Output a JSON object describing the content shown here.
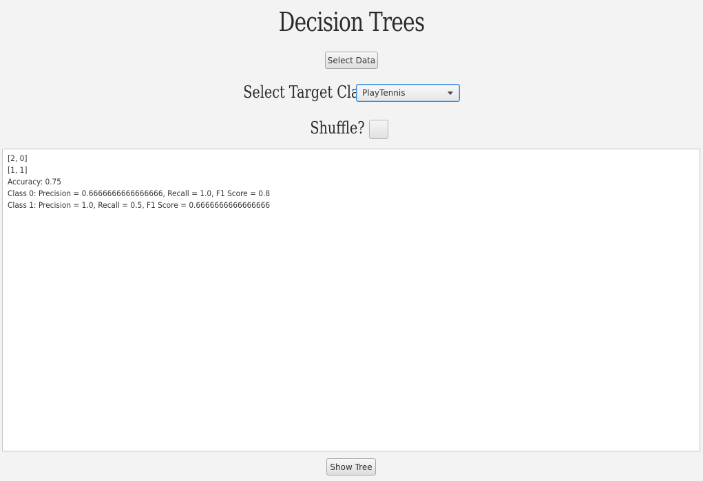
{
  "app": {
    "title": "Decision Trees"
  },
  "controls": {
    "select_data_label": "Select Data",
    "target_class_label": "Select Target Class",
    "target_class_value": "PlayTennis",
    "shuffle_label": "Shuffle?",
    "shuffle_checked": false,
    "show_tree_label": "Show Tree"
  },
  "output": {
    "lines": [
      "[2, 0]",
      "[1, 1]",
      "Accuracy: 0.75",
      "Class 0: Precision = 0.6666666666666666, Recall = 1.0, F1 Score = 0.8",
      "Class 1: Precision = 1.0, Recall = 0.5, F1 Score = 0.6666666666666666"
    ]
  }
}
